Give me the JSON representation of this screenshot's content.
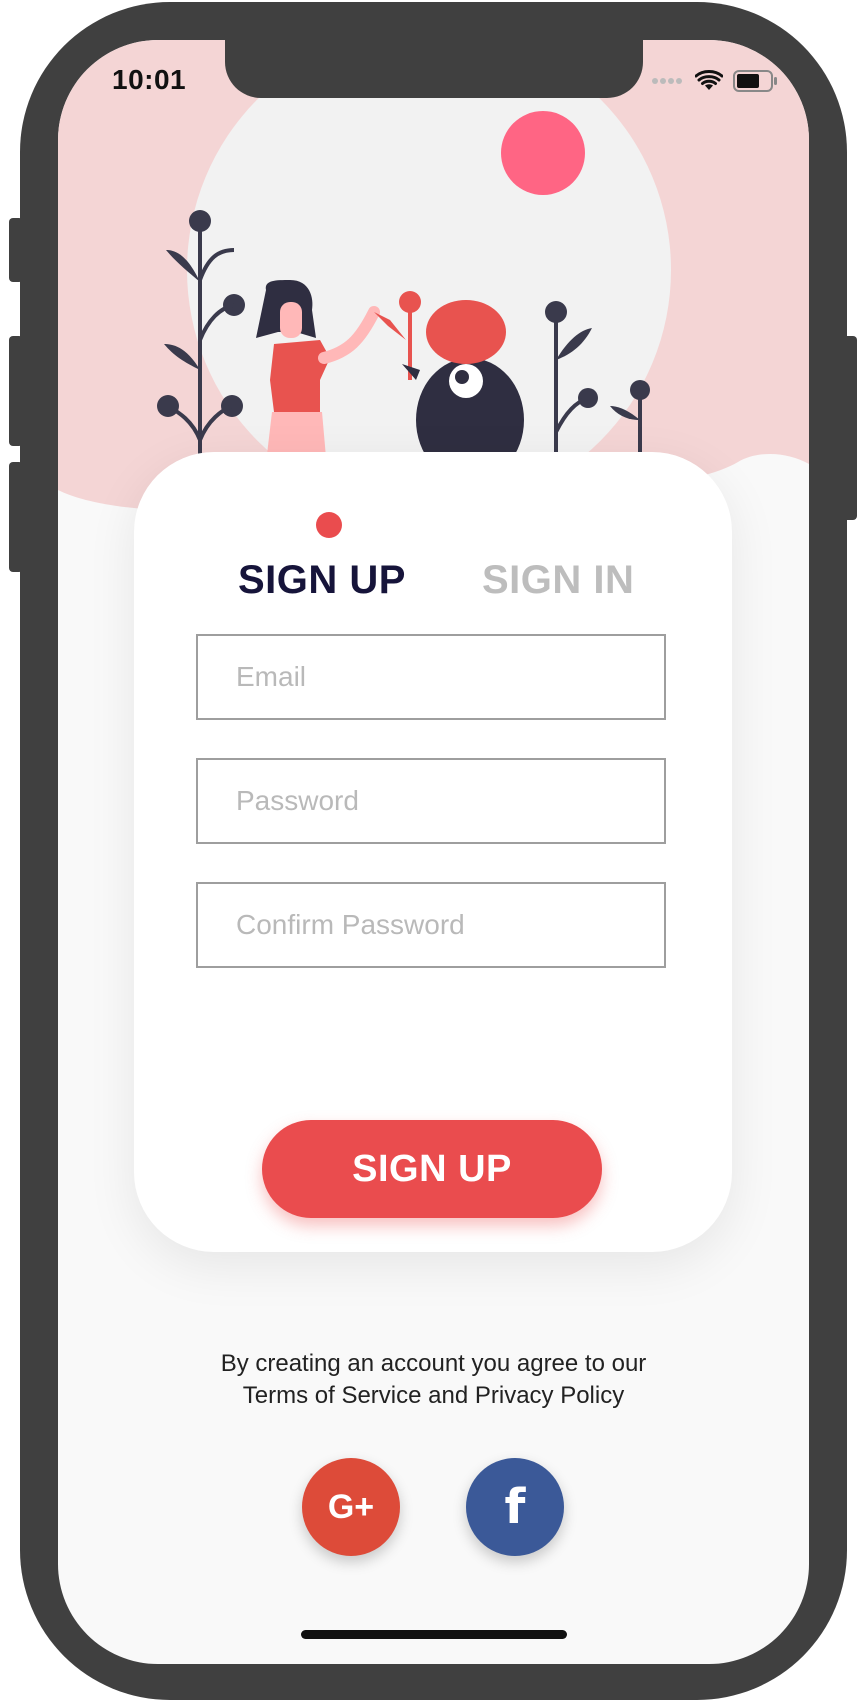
{
  "status_bar": {
    "time": "10:01"
  },
  "tabs": {
    "active": "SIGN UP",
    "inactive": "SIGN IN"
  },
  "form": {
    "email": {
      "placeholder": "Email",
      "value": ""
    },
    "password": {
      "placeholder": "Password",
      "value": ""
    },
    "confirm_password": {
      "placeholder": "Confirm Password",
      "value": ""
    },
    "submit_label": "SIGN UP"
  },
  "terms": {
    "line1": "By creating an account you agree to our",
    "line2": "Terms of Service and Privacy Policy"
  },
  "social": {
    "google_label": "G+",
    "facebook_label": "f"
  },
  "colors": {
    "accent": "#ea4c4e",
    "hero_bg": "#f4d5d5",
    "title_dark": "#16143a",
    "inactive_tab": "#bdbdbd",
    "google": "#dd4b39",
    "facebook": "#3b5998",
    "frame": "#404040"
  }
}
